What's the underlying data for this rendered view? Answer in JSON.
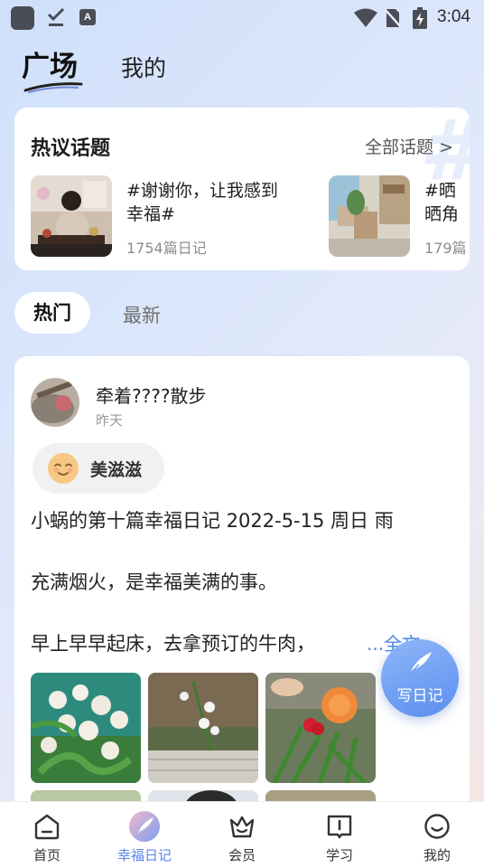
{
  "status_bar": {
    "time": "3:04",
    "notification_letter": "A"
  },
  "header": {
    "tabs": [
      {
        "label": "广场",
        "active": true
      },
      {
        "label": "我的",
        "active": false
      }
    ]
  },
  "topics": {
    "title": "热议话题",
    "all_label": "全部话题 >",
    "watermark": "#",
    "items": [
      {
        "title": "#谢谢你，让我感到幸福#",
        "count": "1754篇日记"
      },
      {
        "title": "#晒晒角落#",
        "count": "179篇"
      }
    ]
  },
  "feed_tabs": [
    {
      "label": "热门",
      "active": true
    },
    {
      "label": "最新",
      "active": false
    }
  ],
  "post": {
    "author": "牵着????散步",
    "time": "昨天",
    "mood": "美滋滋",
    "lines": [
      "小蜗的第十篇幸福日记 2022-5-15 周日 雨",
      "充满烟火，是幸福美满的事。",
      "早上早早起床，去拿预订的牛肉，"
    ],
    "read_more": "...全文"
  },
  "fab": {
    "label": "写日记"
  },
  "bottom_nav": [
    {
      "label": "首页",
      "icon": "home-icon",
      "active": false
    },
    {
      "label": "幸福日记",
      "icon": "feather-icon",
      "active": true
    },
    {
      "label": "会员",
      "icon": "crown-icon",
      "active": false
    },
    {
      "label": "学习",
      "icon": "book-icon",
      "active": false
    },
    {
      "label": "我的",
      "icon": "smile-icon",
      "active": false
    }
  ],
  "colors": {
    "accent": "#5a86e8",
    "link": "#4a86e8"
  }
}
